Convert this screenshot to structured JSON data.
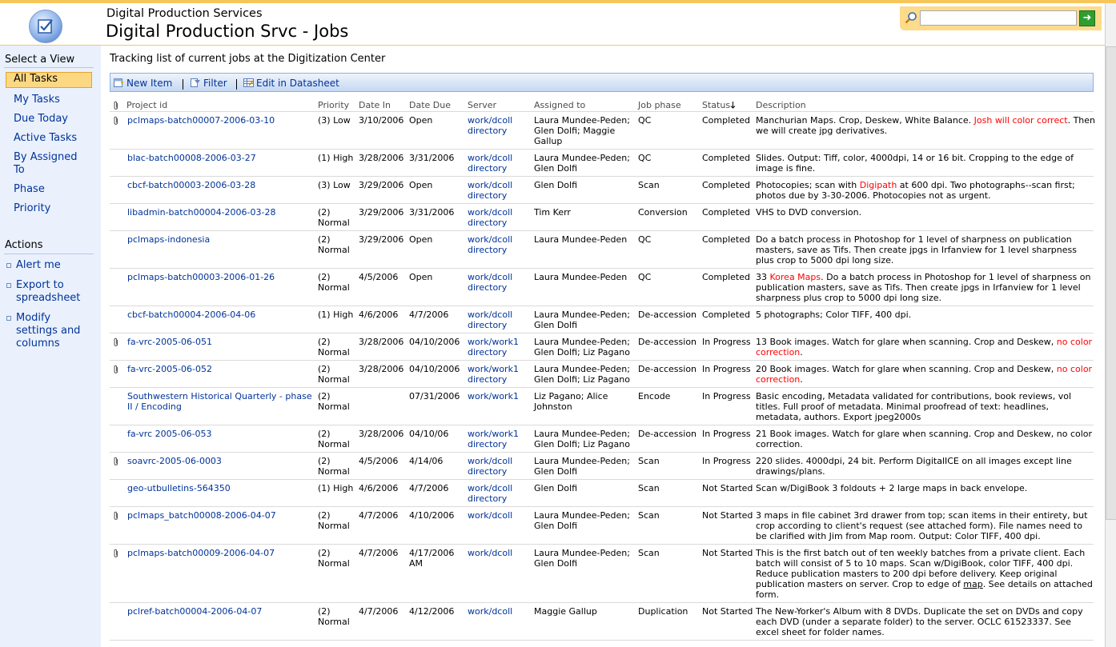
{
  "header": {
    "site_title": "Digital Production Services",
    "page_title": "Digital Production Srvc - Jobs",
    "search_placeholder": ""
  },
  "leftnav": {
    "select_view_heading": "Select a View",
    "views": [
      "All Tasks",
      "My Tasks",
      "Due Today",
      "Active Tasks",
      "By Assigned To",
      "Phase",
      "Priority"
    ],
    "selected_view": "All Tasks",
    "actions_heading": "Actions",
    "actions": [
      "Alert me",
      "Export to spreadsheet",
      "Modify settings and columns"
    ]
  },
  "main": {
    "description": "Tracking list of current jobs at the Digitization Center",
    "toolbar": {
      "new_item": "New Item",
      "filter": "Filter",
      "edit_datasheet": "Edit in Datasheet"
    },
    "columns": [
      "Project id",
      "Priority",
      "Date In",
      "Date Due",
      "Server",
      "Assigned to",
      "Job phase",
      "Status",
      "Description"
    ],
    "sorted_column": "Status",
    "rows": [
      {
        "attachment": true,
        "project": "pclmaps-batch00007-2006-03-10",
        "priority": "(3) Low",
        "date_in": "3/10/2006",
        "date_due": "Open",
        "server": "work/dcoll directory",
        "assigned": "Laura Mundee-Peden; Glen Dolfi; Maggie Gallup",
        "phase": "QC",
        "status": "Completed",
        "desc": [
          {
            "t": "Manchurian Maps.  Crop, Deskew, White Balance.  "
          },
          {
            "t": "Josh will color correct",
            "c": "red"
          },
          {
            "t": ".  Then we will create jpg derivatives."
          }
        ]
      },
      {
        "attachment": false,
        "project": "blac-batch00008-2006-03-27",
        "priority": "(1) High",
        "date_in": "3/28/2006",
        "date_due": "3/31/2006",
        "server": "work/dcoll directory",
        "assigned": "Laura Mundee-Peden; Glen Dolfi",
        "phase": "QC",
        "status": "Completed",
        "desc": [
          {
            "t": "Slides.  Output: Tiff, color, 4000dpi, 14 or 16 bit. Cropping to the edge of image is fine."
          }
        ]
      },
      {
        "attachment": false,
        "project": "cbcf-batch00003-2006-03-28",
        "priority": "(3) Low",
        "date_in": "3/29/2006",
        "date_due": "Open",
        "server": "work/dcoll directory",
        "assigned": "Glen Dolfi",
        "phase": "Scan",
        "status": "Completed",
        "desc": [
          {
            "t": "Photocopies; scan with "
          },
          {
            "t": "Digipath",
            "c": "red"
          },
          {
            "t": " at 600 dpi.  Two photographs--scan first; photos due by 3-30-2006.  Photocopies not as urgent."
          }
        ]
      },
      {
        "attachment": false,
        "project": "libadmin-batch00004-2006-03-28",
        "priority": "(2) Normal",
        "date_in": "3/29/2006",
        "date_due": "3/31/2006",
        "server": "work/dcoll directory",
        "assigned": "Tim Kerr",
        "phase": "Conversion",
        "status": "Completed",
        "desc": [
          {
            "t": "VHS to DVD conversion."
          }
        ]
      },
      {
        "attachment": false,
        "project": "pclmaps-indonesia",
        "priority": "(2) Normal",
        "date_in": "3/29/2006",
        "date_due": "Open",
        "server": "work/dcoll directory",
        "assigned": "Laura Mundee-Peden",
        "phase": "QC",
        "status": "Completed",
        "desc": [
          {
            "t": "Do a batch process in Photoshop for 1 level of sharpness on publication masters, save as Tifs.  Then create jpgs in Irfanview for 1 level sharpness plus crop to 5000 dpi long size."
          }
        ]
      },
      {
        "attachment": false,
        "project": "pclmaps-batch00003-2006-01-26",
        "priority": "(2) Normal",
        "date_in": "4/5/2006",
        "date_due": "Open",
        "server": "work/dcoll directory",
        "assigned": "Laura Mundee-Peden",
        "phase": "QC",
        "status": "Completed",
        "desc": [
          {
            "t": "33 "
          },
          {
            "t": "Korea Maps",
            "c": "red"
          },
          {
            "t": ".  Do a batch process in Photoshop for 1 level of sharpness on publication masters, save as Tifs.  Then create jpgs in Irfanview for 1 level sharpness plus crop to 5000 dpi long size."
          }
        ]
      },
      {
        "attachment": false,
        "project": "cbcf-batch00004-2006-04-06",
        "priority": "(1) High",
        "date_in": "4/6/2006",
        "date_due": "4/7/2006",
        "server": "work/dcoll directory",
        "assigned": "Laura Mundee-Peden; Glen Dolfi",
        "phase": "De-accession",
        "status": "Completed",
        "desc": [
          {
            "t": "5 photographs; Color TIFF, 400 dpi."
          }
        ]
      },
      {
        "attachment": true,
        "project": "fa-vrc-2005-06-051",
        "priority": "(2) Normal",
        "date_in": "3/28/2006",
        "date_due": "04/10/2006",
        "server": "work/work1 directory",
        "assigned": "Laura Mundee-Peden; Glen Dolfi; Liz Pagano",
        "phase": "De-accession",
        "status": "In Progress",
        "desc": [
          {
            "t": "13 Book images. Watch for glare when scanning. Crop and Deskew, "
          },
          {
            "t": "no color correction",
            "c": "red"
          },
          {
            "t": "."
          }
        ]
      },
      {
        "attachment": true,
        "project": "fa-vrc-2005-06-052",
        "priority": "(2) Normal",
        "date_in": "3/28/2006",
        "date_due": "04/10/2006",
        "server": "work/work1 directory",
        "assigned": "Laura Mundee-Peden; Glen Dolfi; Liz Pagano",
        "phase": "De-accession",
        "status": "In Progress",
        "desc": [
          {
            "t": "20 Book images.   Watch for glare when scanning.  Crop and Deskew, "
          },
          {
            "t": "no color correction",
            "c": "red"
          },
          {
            "t": "."
          }
        ]
      },
      {
        "attachment": false,
        "project": "Southwestern Historical Quarterly - phase II / Encoding",
        "priority": "(2) Normal",
        "date_in": "",
        "date_due": "07/31/2006",
        "server": "work/work1",
        "assigned": "Liz Pagano; Alice Johnston",
        "phase": "Encode",
        "status": "In Progress",
        "desc": [
          {
            "t": "Basic encoding, Metadata validated for contributions, book reviews, vol titles. Full proof of metadata. Minimal proofread of text: headlines, metadata, authors. Export jpeg2000s"
          }
        ]
      },
      {
        "attachment": false,
        "project": "fa-vrc 2005-06-053",
        "priority": "(2) Normal",
        "date_in": "3/28/2006",
        "date_due": "04/10/06",
        "server": "work/work1 directory",
        "assigned": "Laura Mundee-Peden; Glen Dolfi; Liz Pagano",
        "phase": "De-accession",
        "status": "In Progress",
        "desc": [
          {
            "t": "21 Book images. Watch for glare when scanning. Crop and Deskew, no color correction."
          }
        ]
      },
      {
        "attachment": true,
        "project": "soavrc-2005-06-0003",
        "priority": "(2) Normal",
        "date_in": "4/5/2006",
        "date_due": "4/14/06",
        "server": "work/dcoll directory",
        "assigned": "Laura Mundee-Peden; Glen Dolfi",
        "phase": "Scan",
        "status": "In Progress",
        "desc": [
          {
            "t": "220 slides.  4000dpi, 24 bit. Perform DigitalICE on all images except line drawings/plans."
          }
        ]
      },
      {
        "attachment": false,
        "project": "geo-utbulletins-564350",
        "priority": "(1) High",
        "date_in": "4/6/2006",
        "date_due": "4/7/2006",
        "server": "work/dcoll directory",
        "assigned": "Glen Dolfi",
        "phase": "Scan",
        "status": "Not Started",
        "desc": [
          {
            "t": "Scan w/DigiBook 3 foldouts + 2 large maps in back envelope."
          }
        ]
      },
      {
        "attachment": true,
        "project": "pclmaps_batch00008-2006-04-07",
        "priority": "(2) Normal",
        "date_in": "4/7/2006",
        "date_due": "4/10/2006",
        "server": "work/dcoll",
        "assigned": "Laura Mundee-Peden; Glen Dolfi",
        "phase": "Scan",
        "status": "Not Started",
        "desc": [
          {
            "t": "3 maps in file cabinet 3rd drawer from top; scan items in their entirety, but crop according to client's request (see attached form). File names need to be clarified with Jim from Map room. Output: Color TIFF, 400 dpi."
          }
        ]
      },
      {
        "attachment": true,
        "project": "pclmaps-batch00009-2006-04-07",
        "priority": "(2) Normal",
        "date_in": "4/7/2006",
        "date_due": "4/17/2006 AM",
        "server": "work/dcoll",
        "assigned": "Laura Mundee-Peden; Glen Dolfi",
        "phase": "Scan",
        "status": "Not Started",
        "desc": [
          {
            "t": "This is the first batch out of ten weekly batches from a private client. Each batch will consist of 5 to 10 maps. Scan w/DigiBook, color TIFF, 400 dpi. Reduce publication masters to 200 dpi before delivery. Keep original publication masters on server. Crop to edge of "
          },
          {
            "t": "map",
            "c": "u"
          },
          {
            "t": ". See details on attached form."
          }
        ]
      },
      {
        "attachment": false,
        "project": "pclref-batch00004-2006-04-07",
        "priority": "(2) Normal",
        "date_in": "4/7/2006",
        "date_due": "4/12/2006",
        "server": "work/dcoll",
        "assigned": "Maggie Gallup",
        "phase": "Duplication",
        "status": "Not Started",
        "desc": [
          {
            "t": "The New-Yorker's Album with 8 DVDs. Duplicate the set on DVDs and copy each DVD (under a separate folder) to the server. OCLC 61523337. See excel sheet for folder names."
          }
        ]
      }
    ]
  }
}
